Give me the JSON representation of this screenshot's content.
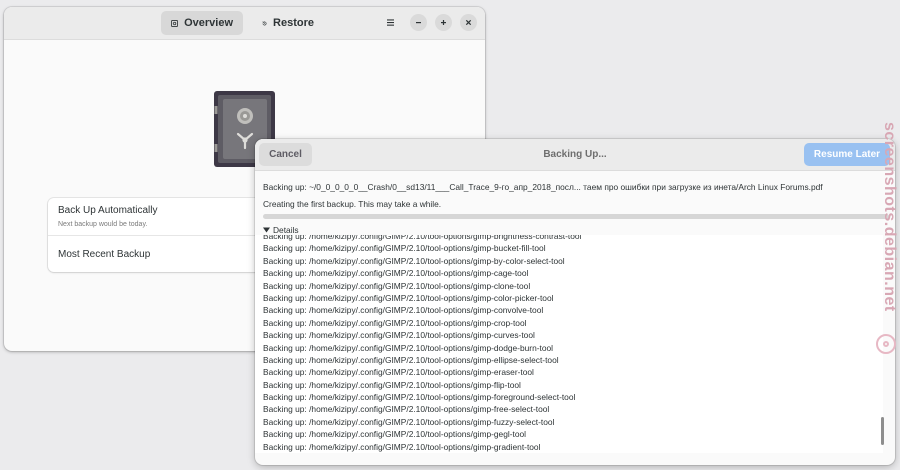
{
  "main_window": {
    "tabs": [
      {
        "label": "Overview",
        "icon": "safe-icon",
        "active": true
      },
      {
        "label": "Restore",
        "icon": "history-icon",
        "active": false
      }
    ],
    "controls": {
      "menu": "menu-icon",
      "minimize": "minimize-icon",
      "maximize": "maximize-icon",
      "close": "close-icon"
    },
    "settings": {
      "auto_backup_title": "Back Up Automatically",
      "auto_backup_subtitle": "Next backup would be today.",
      "recent_backup_title": "Most Recent Backup"
    }
  },
  "dialog": {
    "cancel_label": "Cancel",
    "title": "Backing Up...",
    "resume_label": "Resume Later",
    "status": "Backing up: ~/0_0_0_0_0__Crash/0__sd13/11___Call_Trace_9-го_апр_2018_посл... таем про ошибки при загрузке из инета/Arch Linux Forums.pdf",
    "first_backup_text": "Creating the first backup.  This may take a while.",
    "progress": 0.0,
    "details_label": "Details",
    "log_lines": [
      "Backing up: /home/kizipy/.config/GIMP/2.10/tool-options/gimp-brightness-contrast-tool",
      "Backing up: /home/kizipy/.config/GIMP/2.10/tool-options/gimp-bucket-fill-tool",
      "Backing up: /home/kizipy/.config/GIMP/2.10/tool-options/gimp-by-color-select-tool",
      "Backing up: /home/kizipy/.config/GIMP/2.10/tool-options/gimp-cage-tool",
      "Backing up: /home/kizipy/.config/GIMP/2.10/tool-options/gimp-clone-tool",
      "Backing up: /home/kizipy/.config/GIMP/2.10/tool-options/gimp-color-picker-tool",
      "Backing up: /home/kizipy/.config/GIMP/2.10/tool-options/gimp-convolve-tool",
      "Backing up: /home/kizipy/.config/GIMP/2.10/tool-options/gimp-crop-tool",
      "Backing up: /home/kizipy/.config/GIMP/2.10/tool-options/gimp-curves-tool",
      "Backing up: /home/kizipy/.config/GIMP/2.10/tool-options/gimp-dodge-burn-tool",
      "Backing up: /home/kizipy/.config/GIMP/2.10/tool-options/gimp-ellipse-select-tool",
      "Backing up: /home/kizipy/.config/GIMP/2.10/tool-options/gimp-eraser-tool",
      "Backing up: /home/kizipy/.config/GIMP/2.10/tool-options/gimp-flip-tool",
      "Backing up: /home/kizipy/.config/GIMP/2.10/tool-options/gimp-foreground-select-tool",
      "Backing up: /home/kizipy/.config/GIMP/2.10/tool-options/gimp-free-select-tool",
      "Backing up: /home/kizipy/.config/GIMP/2.10/tool-options/gimp-fuzzy-select-tool",
      "Backing up: /home/kizipy/.config/GIMP/2.10/tool-options/gimp-gegl-tool",
      "Backing up: /home/kizipy/.config/GIMP/2.10/tool-options/gimp-gradient-tool"
    ]
  },
  "watermark": "screenshots.debian.net",
  "colors": {
    "accent": "#3584e4",
    "resume_button": "#99c1f1",
    "watermark": "#d8a7b4"
  }
}
